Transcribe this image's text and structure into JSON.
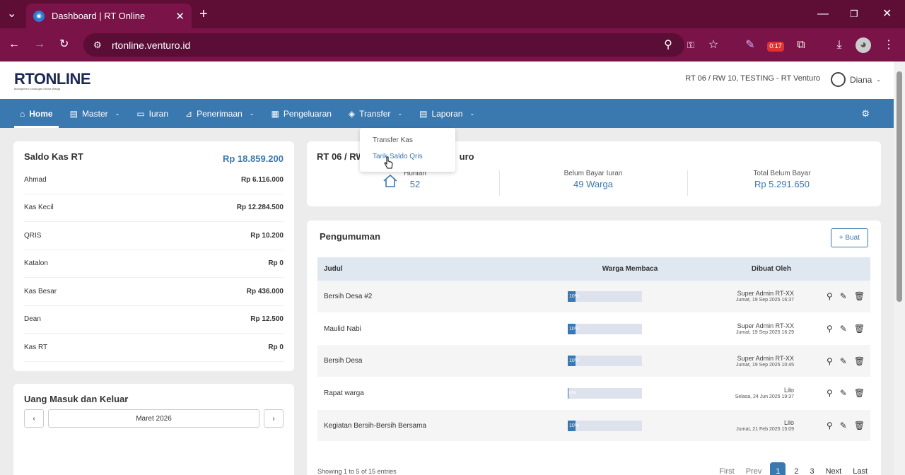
{
  "browser": {
    "tab_title": "Dashboard | RT Online",
    "url": "rtonline.venturo.id",
    "badge": "0:17"
  },
  "app": {
    "logo": "RTONLINE",
    "logo_tag": "Manajemen Keuangan Kelola Warga",
    "rt_info": "RT 06 / RW 10, TESTING - RT Venturo",
    "user_name": "Diana"
  },
  "nav": [
    {
      "label": "Home",
      "icon": "home-icon",
      "active": true
    },
    {
      "label": "Master",
      "icon": "document-icon",
      "dropdown": true
    },
    {
      "label": "Iuran",
      "icon": "card-icon"
    },
    {
      "label": "Penerimaan",
      "icon": "chart-icon",
      "dropdown": true
    },
    {
      "label": "Pengeluaran",
      "icon": "receipt-icon"
    },
    {
      "label": "Transfer",
      "icon": "tag-icon",
      "dropdown": true
    },
    {
      "label": "Laporan",
      "icon": "document-icon",
      "dropdown": true
    }
  ],
  "transfer_menu": [
    "Transfer Kas",
    "Tarik Saldo Qris"
  ],
  "saldo": {
    "title": "Saldo Kas RT",
    "total": "Rp 18.859.200",
    "items": [
      {
        "name": "Ahmad",
        "amount": "Rp 6.116.000"
      },
      {
        "name": "Kas Kecil",
        "amount": "Rp 12.284.500"
      },
      {
        "name": "QRIS",
        "amount": "Rp 10.200"
      },
      {
        "name": "Katalon",
        "amount": "Rp 0"
      },
      {
        "name": "Kas Besar",
        "amount": "Rp 436.000"
      },
      {
        "name": "Dean",
        "amount": "Rp 12.500"
      },
      {
        "name": "Kas RT",
        "amount": "Rp 0"
      }
    ]
  },
  "uang": {
    "title": "Uang Masuk dan Keluar",
    "prev": "‹",
    "next": "›",
    "month": "Maret 2026"
  },
  "rt_card": {
    "title_left": "RT 06 / RW",
    "title_right": "uro",
    "hunian_label": "Hunian",
    "hunian_value": "52",
    "belum_label": "Belum Bayar Iuran",
    "belum_value": "49 Warga",
    "total_label": "Total Belum Bayar",
    "total_value": "Rp 5.291.650"
  },
  "pengumuman": {
    "title": "Pengumuman",
    "create_label": "+ Buat",
    "headers": {
      "judul": "Judul",
      "warga": "Warga Membaca",
      "dibuat": "Dibuat Oleh"
    },
    "rows": [
      {
        "judul": "Bersih Desa #2",
        "pct_label": "10%",
        "pct": 0.1,
        "author": "Super Admin RT-XX",
        "date": "Jumat, 19 Sep 2025 16:37"
      },
      {
        "judul": "Maulid Nabi",
        "pct_label": "10%",
        "pct": 0.1,
        "author": "Super Admin RT-XX",
        "date": "Jumat, 19 Sep 2025 16:29"
      },
      {
        "judul": "Bersih Desa",
        "pct_label": "10%",
        "pct": 0.1,
        "author": "Super Admin RT-XX",
        "date": "Jumat, 19 Sep 2025 10:45"
      },
      {
        "judul": "Rapat warga",
        "pct_label": "0%",
        "pct": 0,
        "author": "Lilo",
        "date": "Selasa, 24 Jun 2025 19:37"
      },
      {
        "judul": "Kegiatan Bersih-Bersih Bersama",
        "pct_label": "10%",
        "pct": 0.1,
        "author": "Lilo",
        "date": "Jumat, 21 Feb 2025 15:09"
      }
    ],
    "showing": "Showing 1 to 5 of 15 entries",
    "pager": [
      "First",
      "Prev",
      "1",
      "2",
      "3",
      "Next",
      "Last"
    ]
  }
}
